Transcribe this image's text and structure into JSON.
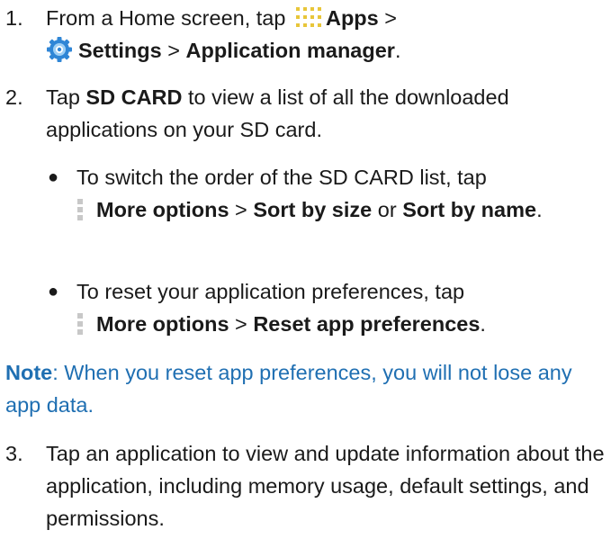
{
  "steps": [
    {
      "number": "1.",
      "t1": "From a Home screen, tap ",
      "apps": "Apps",
      "sep1": " >",
      "settings": "Settings",
      "sep2": " > ",
      "appmgr": "Application manager",
      "end": ".",
      "apps_icon": "apps-grid-icon",
      "settings_icon": "settings-gear-icon"
    },
    {
      "number": "2.",
      "t1": "Tap ",
      "sdcard": "SD CARD",
      "t2": " to view a list of all the downloaded applications on your SD card."
    },
    {
      "number": "3.",
      "text": "Tap an application to view and update information about the application, including memory usage, default settings, and permissions."
    }
  ],
  "bullets": [
    {
      "t1": "To switch the order of the SD CARD list, tap",
      "more": "More options",
      "sep1": " > ",
      "sortsize": "Sort by size",
      "or": " or ",
      "sortname": "Sort by name",
      "end": ".",
      "icon": "more-options-icon"
    },
    {
      "t1": "To reset your application preferences, tap",
      "more": "More options",
      "sep1": " > ",
      "reset": "Reset app preferences",
      "end": ".",
      "icon": "more-options-icon"
    }
  ],
  "note": {
    "label": "Note",
    "text": ": When you reset app preferences, you will not lose any app data."
  },
  "colors": {
    "note": "#1f6fb2",
    "text": "#1a1a1a",
    "apps_icon": "#e8c63a",
    "settings_icon": "#2f86d6",
    "more_icon": "#c8c8c8"
  }
}
